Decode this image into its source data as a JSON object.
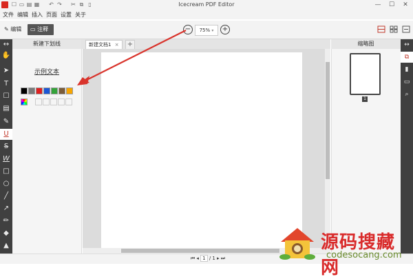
{
  "app": {
    "title": "Icecream PDF Editor"
  },
  "quick_access": [
    "☐",
    "▭",
    "▤",
    "▦",
    "↶",
    "↷",
    "✂",
    "⧉",
    "▯"
  ],
  "window_controls": {
    "minimize": "—",
    "maximize": "☐",
    "close": "✕"
  },
  "menu": [
    "文件",
    "编辑",
    "插入",
    "页面",
    "设置",
    "关于"
  ],
  "toolbar": {
    "edit_label": "编辑",
    "annotate_label": "注释",
    "zoom_value": "75%",
    "zoom_out": "−",
    "zoom_in": "+"
  },
  "left_tools": [
    {
      "name": "collapse-left-icon",
      "glyph": "↔"
    },
    {
      "name": "hand-tool-icon",
      "glyph": "✋"
    },
    {
      "name": "select-tool-icon",
      "glyph": "➤"
    },
    {
      "name": "text-tool-icon",
      "glyph": "T"
    },
    {
      "name": "comment-tool-icon",
      "glyph": "☐"
    },
    {
      "name": "note-tool-icon",
      "glyph": "▤"
    },
    {
      "name": "highlight-tool-icon",
      "glyph": "✎"
    },
    {
      "name": "underline-tool-icon",
      "glyph": "U"
    },
    {
      "name": "strikethrough-tool-icon",
      "glyph": "S"
    },
    {
      "name": "squiggly-tool-icon",
      "glyph": "W"
    },
    {
      "name": "rectangle-tool-icon",
      "glyph": "□"
    },
    {
      "name": "ellipse-tool-icon",
      "glyph": "○"
    },
    {
      "name": "line-tool-icon",
      "glyph": "╱"
    },
    {
      "name": "arrow-tool-icon",
      "glyph": "↗"
    },
    {
      "name": "pencil-tool-icon",
      "glyph": "✏"
    },
    {
      "name": "eraser-tool-icon",
      "glyph": "◆"
    },
    {
      "name": "stamp-tool-icon",
      "glyph": "▲"
    }
  ],
  "left_panel": {
    "header": "新建下划线",
    "sample_text": "示例文本",
    "colors": [
      "#000000",
      "#7a7a7a",
      "#e02020",
      "#1c57d6",
      "#34a33a",
      "#7a5c3a",
      "#f7a500"
    ]
  },
  "tabs": [
    {
      "label": "新建文档1"
    }
  ],
  "tab_close": "×",
  "tab_add": "+",
  "right_panel": {
    "header": "缩略图",
    "page_number": "1"
  },
  "right_tools": [
    {
      "name": "collapse-right-icon",
      "glyph": "↔"
    },
    {
      "name": "pages-panel-icon",
      "glyph": "⧉"
    },
    {
      "name": "bookmark-icon",
      "glyph": "▮"
    },
    {
      "name": "comments-panel-icon",
      "glyph": "▭"
    },
    {
      "name": "search-icon",
      "glyph": "⌕"
    }
  ],
  "pager": {
    "current": "1",
    "total": "/ 1"
  },
  "watermark": {
    "text": "源码搜藏网",
    "url": "codesocang.com"
  },
  "colors": {
    "dark_rail": "#404040",
    "accent": "#d9281f",
    "arrow": "#d9342c"
  }
}
